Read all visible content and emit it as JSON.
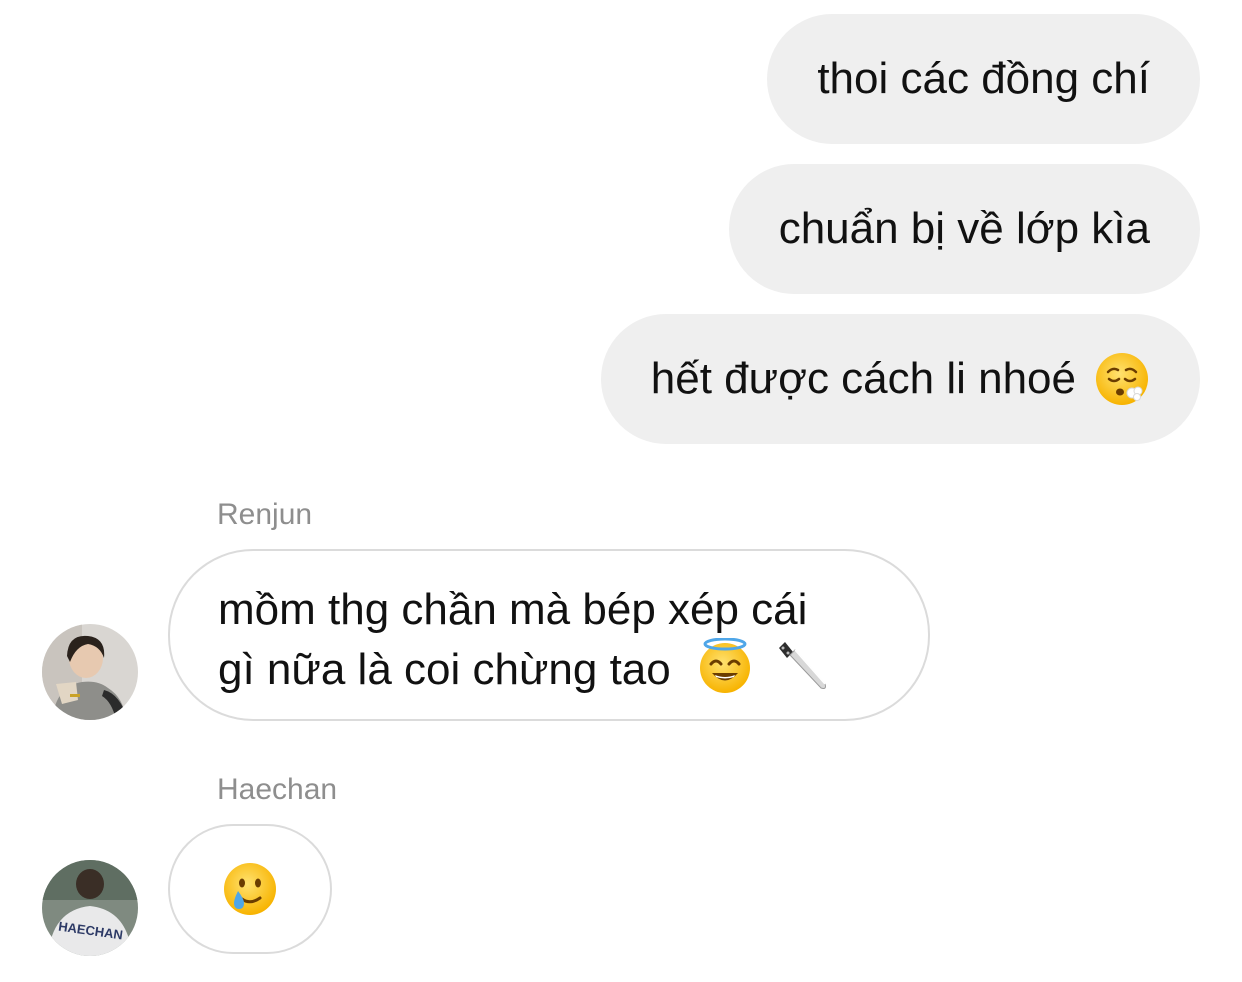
{
  "conversation": {
    "outgoing": [
      {
        "text": "thoi các đồng chí"
      },
      {
        "text": "chuẩn bị về lớp kìa"
      },
      {
        "text": "hết được cách li nhoé",
        "emoji": "face-exhaling-icon"
      }
    ],
    "incoming": [
      {
        "sender": "Renjun",
        "avatar": "renjun-avatar",
        "line1": "mồm thg chần mà bép xép cái",
        "line2": "gì nữa là coi chừng tao",
        "emojis": [
          "smiling-face-with-halo-icon",
          "kitchen-knife-icon"
        ]
      },
      {
        "sender": "Haechan",
        "avatar": "haechan-avatar",
        "emoji": "smiling-face-with-tear-icon",
        "avatar_text": "HAECHAN"
      }
    ]
  },
  "colors": {
    "outgoing_bubble": "#efefef",
    "incoming_border": "#dbdbdb",
    "sender_name": "#8e8e8e",
    "text": "#111111"
  }
}
